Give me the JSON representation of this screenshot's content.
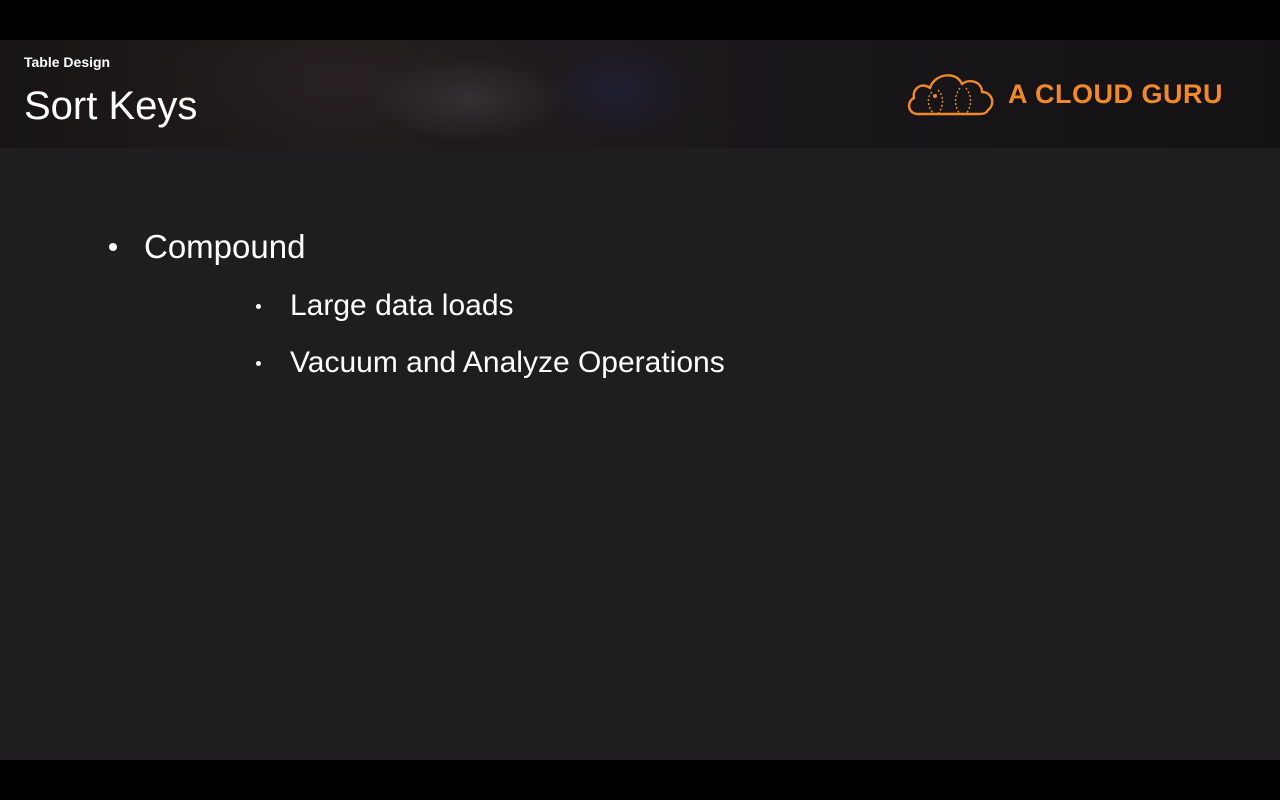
{
  "header": {
    "section_label": "Table Design",
    "title": "Sort Keys"
  },
  "logo": {
    "text": "A CLOUD GURU",
    "icon": "cloud-logo-icon",
    "color": "#f08a28"
  },
  "bullets": [
    {
      "label": "Compound",
      "children": [
        {
          "label": "Large data loads"
        },
        {
          "label": "Vacuum and Analyze Operations"
        }
      ]
    }
  ],
  "colors": {
    "slide_background": "#1f1d20",
    "text": "#ffffff",
    "accent": "#f08a28"
  }
}
